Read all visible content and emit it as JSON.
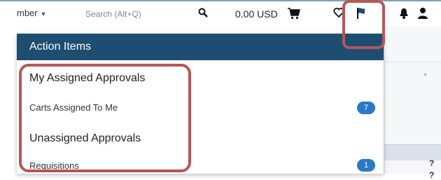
{
  "topbar": {
    "member_label": "mber",
    "search_placeholder": "Search (Alt+Q)",
    "cart_total": "0.00 USD"
  },
  "dropdown": {
    "header": "Action Items",
    "sections": [
      {
        "title": "My Assigned Approvals",
        "items": [
          {
            "label": "Carts Assigned To Me",
            "count": "7"
          }
        ]
      },
      {
        "title": "Unassigned Approvals",
        "items": [
          {
            "label": "Requisitions",
            "count": "1"
          }
        ]
      }
    ]
  },
  "background_table": {
    "help_marks": [
      "?",
      "?"
    ]
  },
  "icons": [
    "chevron-down-icon",
    "search-icon",
    "cart-icon",
    "heart-icon",
    "flag-icon",
    "bell-icon",
    "user-icon"
  ],
  "colors": {
    "header_bg": "#1e4d72",
    "badge_bg": "#2a78c8",
    "highlight": "#b5565a",
    "top_border": "#7fa0c0"
  }
}
